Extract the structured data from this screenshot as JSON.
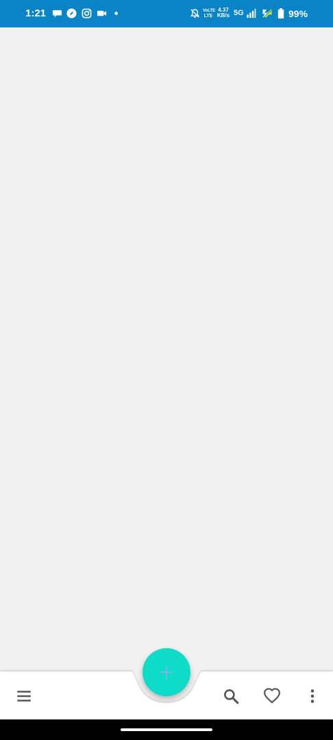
{
  "status_bar": {
    "time": "1:21",
    "volte_top": "VoLTE",
    "volte_bottom": "LTE",
    "speed_top": "4.37",
    "speed_bottom": "KB/s",
    "network": "5G",
    "battery": "99%",
    "icons": [
      "chat-bubble-icon",
      "compass-icon",
      "instagram-icon",
      "video-camera-icon",
      "notification-dot-icon",
      "bell-off-icon",
      "signal-icon",
      "charging-icon",
      "battery-icon"
    ]
  },
  "bottom_bar": {
    "icons": [
      "menu-icon",
      "search-icon",
      "heart-icon",
      "more-vert-icon"
    ],
    "fab_icon": "plus-icon"
  },
  "colors": {
    "status_bar": "#0a84c6",
    "background": "#f1f1f1",
    "fab": "#0fdcc8",
    "fab_plus": "#6fb8f0",
    "icon": "#555555"
  }
}
